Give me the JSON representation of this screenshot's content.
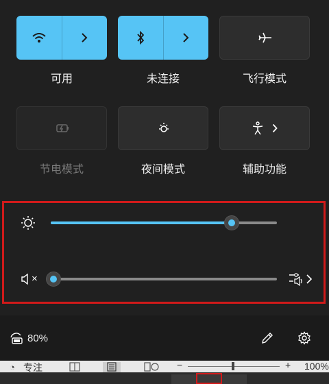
{
  "tiles": [
    {
      "label": "可用",
      "state": "on",
      "icon": "wifi-icon"
    },
    {
      "label": "未连接",
      "state": "on",
      "icon": "bluetooth-icon"
    },
    {
      "label": "飞行模式",
      "state": "off",
      "icon": "airplane-icon"
    },
    {
      "label": "节电模式",
      "state": "disabled",
      "icon": "battery-saver-icon"
    },
    {
      "label": "夜间模式",
      "state": "off",
      "icon": "night-light-icon"
    },
    {
      "label": "辅助功能",
      "state": "off",
      "icon": "accessibility-icon"
    }
  ],
  "sliders": {
    "brightness": {
      "icon": "brightness-icon",
      "level": 0.8
    },
    "volume": {
      "icon": "volume-muted-icon",
      "level": 0.0,
      "muted_mark": "×"
    }
  },
  "footer": {
    "battery": "80%",
    "edit_icon": "pencil-icon",
    "settings_icon": "gear-icon"
  },
  "taskbar": {
    "focus_label": "专注",
    "zoom_minus": "−",
    "zoom_plus": "+",
    "zoom_value": "100%"
  },
  "colors": {
    "accent": "#56c4f5",
    "highlight_box": "#d11a1a",
    "panel_bg": "#202020"
  }
}
